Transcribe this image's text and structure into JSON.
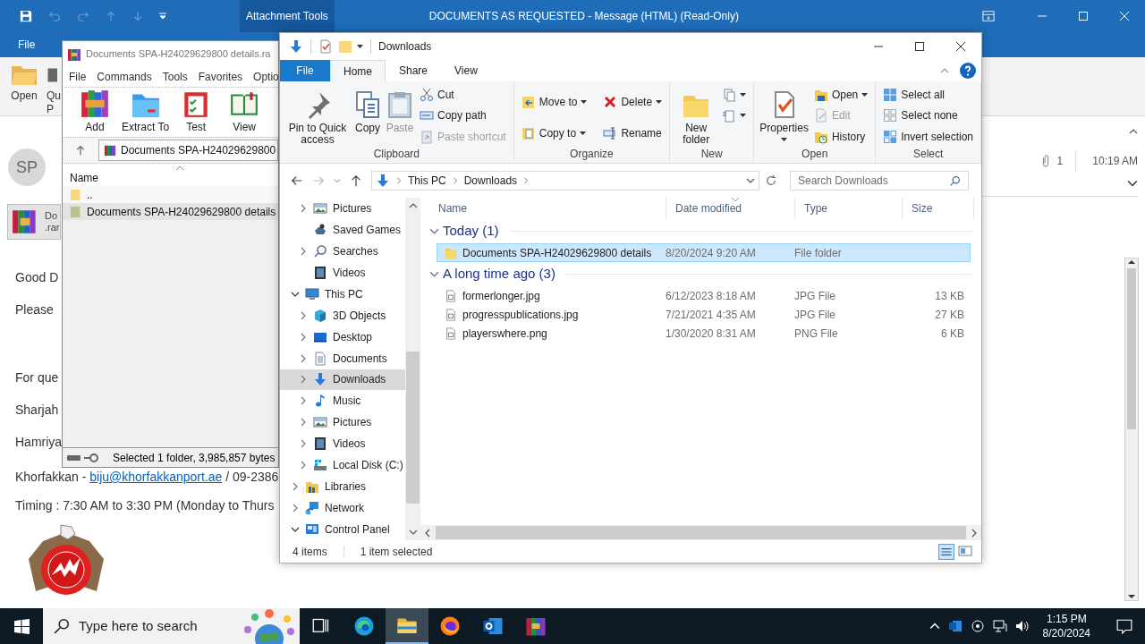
{
  "outlook": {
    "title": "DOCUMENTS AS REQUESTED  -  Message (HTML) (Read-Only)",
    "contextual_tab": "Attachment Tools",
    "file_tab": "File",
    "ribbon_buttons": [
      {
        "lines": [
          "Open"
        ]
      },
      {
        "lines": [
          "Qu",
          "P"
        ]
      }
    ],
    "sender_initials": "SP",
    "attachment": {
      "name": "Do",
      "ext": ".rar"
    },
    "attachment_count": "1",
    "received": "10:19 AM",
    "body": [
      {
        "text": "Good D"
      },
      {
        "text": "Please"
      },
      {
        "text": "For que"
      },
      {
        "text": "Sharjah"
      },
      {
        "text": "Hamriya"
      },
      {
        "text": "Khorfakkan - ",
        "link": "biju@khorfakkanport.ae",
        "after": " / 09-2386"
      },
      {
        "text": "Timing : 7:30 AM to 3:30 PM (Monday to Thurs"
      }
    ]
  },
  "winrar": {
    "title": "Documents SPA-H24029629800 details.ra",
    "menu": [
      "File",
      "Commands",
      "Tools",
      "Favorites",
      "Optio"
    ],
    "tools": [
      {
        "label": "Add"
      },
      {
        "label": "Extract To"
      },
      {
        "label": "Test"
      },
      {
        "label": "View"
      }
    ],
    "path": "Documents SPA-H24029629800",
    "column": "Name",
    "rows": [
      {
        "name": "..",
        "kind": "parent",
        "selected": false
      },
      {
        "name": "Documents SPA-H24029629800 details",
        "kind": "folder",
        "selected": true
      }
    ],
    "status": "Selected 1 folder, 3,985,857 bytes"
  },
  "explorer": {
    "title": "Downloads",
    "tabs": [
      {
        "label": "File",
        "kind": "file",
        "selected": false
      },
      {
        "label": "Home",
        "kind": "tab",
        "selected": true
      },
      {
        "label": "Share",
        "kind": "tab",
        "selected": false
      },
      {
        "label": "View",
        "kind": "tab",
        "selected": false
      }
    ],
    "ribbon_groups": [
      {
        "label": "Clipboard",
        "items": [
          {
            "kind": "large",
            "label": "Pin to Quick access",
            "disabled": false,
            "dropdown": false
          },
          {
            "kind": "large",
            "label": "Copy",
            "disabled": false,
            "dropdown": false
          },
          {
            "kind": "large",
            "label": "Paste",
            "disabled": true,
            "dropdown": false
          },
          {
            "kind": "small",
            "label": "Cut",
            "disabled": false,
            "dropdown": false
          },
          {
            "kind": "small",
            "label": "Copy path",
            "disabled": false,
            "dropdown": false
          },
          {
            "kind": "small",
            "label": "Paste shortcut",
            "disabled": true,
            "dropdown": false
          }
        ]
      },
      {
        "label": "Organize",
        "items": [
          {
            "kind": "small",
            "label": "Move to",
            "disabled": false,
            "dropdown": true
          },
          {
            "kind": "small",
            "label": "Copy to",
            "disabled": false,
            "dropdown": true
          },
          {
            "kind": "small",
            "label": "Delete",
            "disabled": false,
            "dropdown": true
          },
          {
            "kind": "small",
            "label": "Rename",
            "disabled": false,
            "dropdown": false
          }
        ]
      },
      {
        "label": "New",
        "items": [
          {
            "kind": "large",
            "label": "New folder",
            "disabled": false,
            "dropdown": false
          },
          {
            "kind": "small",
            "disabled": false,
            "dropdown": true
          },
          {
            "kind": "small",
            "disabled": false,
            "dropdown": true
          }
        ]
      },
      {
        "label": "Open",
        "items": [
          {
            "kind": "large",
            "label": "Properties",
            "disabled": false,
            "dropdown": true
          },
          {
            "kind": "small",
            "label": "Open",
            "disabled": false,
            "dropdown": true
          },
          {
            "kind": "small",
            "label": "Edit",
            "disabled": true,
            "dropdown": false
          },
          {
            "kind": "small",
            "label": "History",
            "disabled": false,
            "dropdown": false
          }
        ]
      },
      {
        "label": "Select",
        "items": [
          {
            "kind": "small",
            "label": "Select all",
            "disabled": false,
            "dropdown": false
          },
          {
            "kind": "small",
            "label": "Select none",
            "disabled": false,
            "dropdown": false
          },
          {
            "kind": "small",
            "label": "Invert selection",
            "disabled": false,
            "dropdown": false
          }
        ]
      }
    ],
    "address": [
      "This PC",
      "Downloads"
    ],
    "search_placeholder": "Search Downloads",
    "nav": [
      {
        "children": [
          {
            "label": "Pictures",
            "expandable": true,
            "expanded": false,
            "selected": false
          },
          {
            "label": "Saved Games",
            "expandable": false,
            "selected": false
          },
          {
            "label": "Searches",
            "expandable": true,
            "expanded": false,
            "selected": false
          },
          {
            "label": "Videos",
            "expandable": false,
            "selected": false
          }
        ]
      },
      {
        "label": "This PC",
        "expandable": true,
        "expanded": true,
        "selected": false,
        "children": [
          {
            "label": "3D Objects",
            "expandable": true,
            "expanded": false,
            "selected": false
          },
          {
            "label": "Desktop",
            "expandable": true,
            "expanded": false,
            "selected": false
          },
          {
            "label": "Documents",
            "expandable": true,
            "expanded": false,
            "selected": false
          },
          {
            "label": "Downloads",
            "expandable": true,
            "expanded": false,
            "selected": true
          },
          {
            "label": "Music",
            "expandable": true,
            "expanded": false,
            "selected": false
          },
          {
            "label": "Pictures",
            "expandable": true,
            "expanded": false,
            "selected": false
          },
          {
            "label": "Videos",
            "expandable": true,
            "expanded": false,
            "selected": false
          },
          {
            "label": "Local Disk (C:)",
            "expandable": true,
            "expanded": false,
            "selected": false
          }
        ]
      },
      {
        "label": "Libraries",
        "expandable": true,
        "expanded": false,
        "selected": false
      },
      {
        "label": "Network",
        "expandable": true,
        "expanded": false,
        "selected": false
      },
      {
        "label": "Control Panel",
        "expandable": true,
        "expanded": true,
        "selected": false
      }
    ],
    "columns": [
      {
        "label": "Name",
        "sorted": false
      },
      {
        "label": "Date modified",
        "sorted": true
      },
      {
        "label": "Type",
        "sorted": false
      },
      {
        "label": "Size",
        "sorted": false
      }
    ],
    "groups": [
      {
        "title": "Today (1)",
        "expanded": true,
        "files": [
          {
            "name": "Documents SPA-H24029629800 details",
            "date": "8/20/2024 9:20 AM",
            "type": "File folder",
            "kind": "folder",
            "selected": true
          }
        ]
      },
      {
        "title": "A long time ago (3)",
        "expanded": true,
        "files": [
          {
            "name": "formerlonger.jpg",
            "date": "6/12/2023 8:18 AM",
            "type": "JPG File",
            "size": "13 KB",
            "kind": "image",
            "selected": false
          },
          {
            "name": "progresspublications.jpg",
            "date": "7/21/2021 4:35 AM",
            "type": "JPG File",
            "size": "27 KB",
            "kind": "image",
            "selected": false
          },
          {
            "name": "playerswhere.png",
            "date": "1/30/2020 8:31 AM",
            "type": "PNG File",
            "size": "6 KB",
            "kind": "image",
            "selected": false
          }
        ]
      }
    ],
    "item_count": "4 items",
    "selection": "1 item selected"
  },
  "taskbar": {
    "search_placeholder": "Type here to search",
    "apps": [
      {
        "selected": false
      },
      {
        "selected": false
      },
      {
        "selected": true
      },
      {
        "selected": false
      },
      {
        "selected": false
      },
      {
        "selected": false
      }
    ],
    "time": "1:15 PM",
    "date": "8/20/2024"
  }
}
